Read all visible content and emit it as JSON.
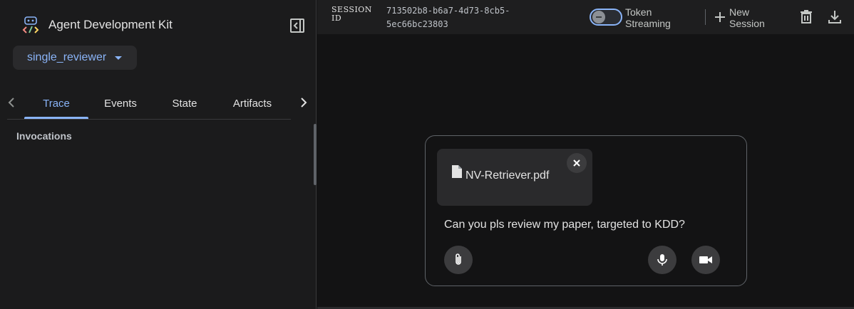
{
  "app": {
    "title": "Agent Development Kit",
    "icons": {
      "logo": "adk-logo-icon",
      "collapse": "sidebar-collapse-icon"
    }
  },
  "sidebar": {
    "agent_selector": {
      "value": "single_reviewer",
      "icon": "dropdown-caret-icon"
    },
    "tabs": [
      {
        "label": "Trace",
        "active": true
      },
      {
        "label": "Events",
        "active": false
      },
      {
        "label": "State",
        "active": false
      },
      {
        "label": "Artifacts",
        "active": false
      }
    ],
    "section_title": "Invocations"
  },
  "topbar": {
    "session_label": "SESSION ID",
    "session_id": "713502b8-b6a7-4d73-8cb5-5ec66bc23803",
    "token_streaming": {
      "label": "Token Streaming",
      "enabled": false
    },
    "new_session_label": "New Session",
    "icons": [
      "delete-icon",
      "download-icon"
    ]
  },
  "chat_input": {
    "attachment": {
      "file_name": "NV-Retriever.pdf",
      "icon": "file-icon"
    },
    "text": "Can you pls review my paper, targeted to KDD?",
    "buttons": [
      "attach-icon",
      "mic-icon",
      "video-icon"
    ]
  },
  "colors": {
    "accent": "#8ab4f8",
    "sidebar_bg": "#1b1b1c",
    "main_bg": "#131314",
    "topbar_bg": "#1e1e1f"
  }
}
